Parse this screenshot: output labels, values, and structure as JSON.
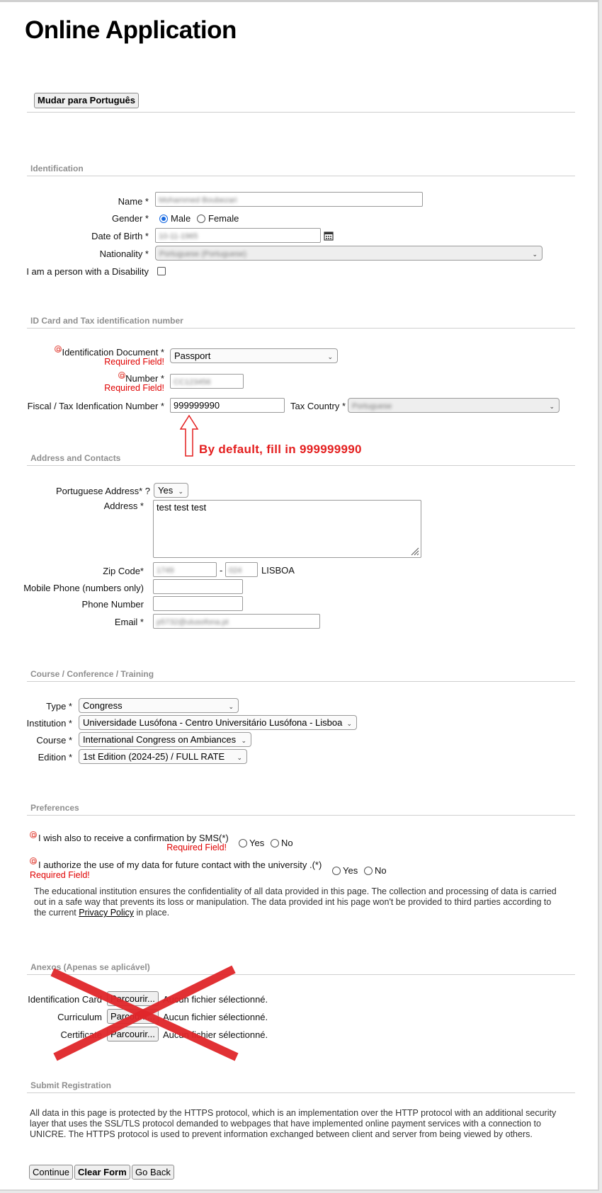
{
  "page": {
    "title": "Online Application"
  },
  "language_button": "Mudar para Português",
  "identification": {
    "section_title": "Identification",
    "name_label": "Name *",
    "name_value": "Mohammed Boubezari",
    "gender_label": "Gender *",
    "gender_options": [
      "Male",
      "Female"
    ],
    "gender_selected": "Male",
    "dob_label": "Date of Birth *",
    "dob_value": "10-11-1965",
    "nationality_label": "Nationality *",
    "nationality_value": "Portuguese (Portuguese)",
    "disability_label": "I am a person with a Disability"
  },
  "id_tax": {
    "section_title": "ID Card and Tax identification number",
    "doc_label": "Identification Document *",
    "doc_required": "Required Field!",
    "doc_value": "Passport",
    "number_label": "Number *",
    "number_required": "Required Field!",
    "number_value": "CC123456",
    "fiscal_label": "Fiscal / Tax Idenfication Number *",
    "fiscal_value": "999999990",
    "tax_country_label": "Tax Country *",
    "tax_country_value": "Portuguese",
    "annotation": "By default, fill in 999999990"
  },
  "address": {
    "section_title": "Address and Contacts",
    "pt_address_label": "Portuguese Address* ?",
    "pt_address_value": "Yes",
    "address_label": "Address *",
    "address_value": "test test test",
    "zip_label": "Zip Code*",
    "zip_part1": "1749",
    "zip_dash": "-",
    "zip_part2": "024",
    "zip_city": "LISBOA",
    "mobile_label": "Mobile Phone (numbers only)",
    "phone_label": "Phone Number",
    "email_label": "Email *",
    "email_value": "p5732@ulusofona.pt"
  },
  "course": {
    "section_title": "Course / Conference / Training",
    "type_label": "Type *",
    "type_value": "Congress",
    "institution_label": "Institution *",
    "institution_value": "Universidade Lusófona - Centro Universitário Lusófona - Lisboa",
    "course_label": "Course *",
    "course_value": "International Congress on Ambiances",
    "edition_label": "Edition *",
    "edition_value": "1st Edition (2024-25) / FULL RATE"
  },
  "preferences": {
    "section_title": "Preferences",
    "sms_label": "I wish also to receive a confirmation by SMS(*)",
    "sms_required": "Required Field!",
    "data_label": "I authorize the use of my data for future contact with the university .(*)",
    "data_required": "Required Field!",
    "yes": "Yes",
    "no": "No",
    "privacy_text_1": "The educational institution ensures the confidentiality of all data provided in this page. The collection and processing of data is carried out in a safe way that prevents its loss or manipulation. The data provided int his page won't be provided to third parties according to the current",
    "privacy_link": "Privacy Policy",
    "privacy_text_2": "in place."
  },
  "annexes": {
    "section_title": "Anexos (Apenas se aplicável)",
    "rows": [
      {
        "label": "Identification Card",
        "button": "Parcourir...",
        "status": "Aucun fichier sélectionné."
      },
      {
        "label": "Curriculum",
        "button": "Parcourir...",
        "status": "Aucun fichier sélectionné."
      },
      {
        "label": "Certificate",
        "button": "Parcourir...",
        "status": "Aucun fichier sélectionné."
      }
    ]
  },
  "submit": {
    "section_title": "Submit Registration",
    "https_text": "All data in this page is protected by the HTTPS protocol, which is an implementation over the HTTP protocol with an additional security layer that uses the SSL/TLS protocol demanded to webpages that have implemented online payment services with a connection to UNICRE. The HTTPS protocol is used to prevent information exchanged between client and server from being viewed by others.",
    "continue": "Continue",
    "clear": "Clear Form",
    "back": "Go Back"
  },
  "colors": {
    "required": "#e00000",
    "annotation": "#e41e1e",
    "radio_selected": "#1769e0"
  }
}
